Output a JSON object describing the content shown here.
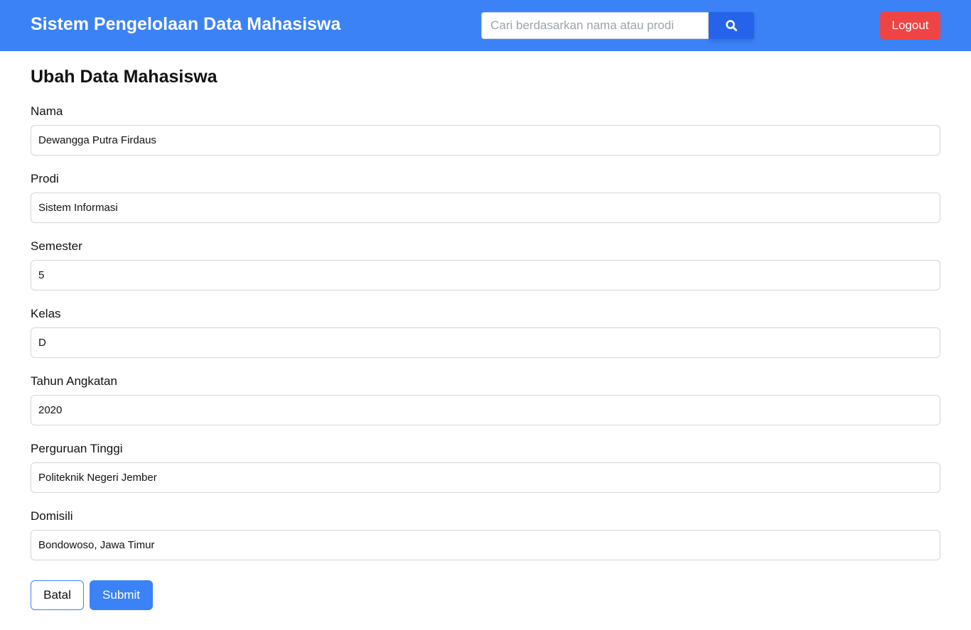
{
  "header": {
    "title": "Sistem Pengelolaan Data Mahasiswa",
    "search_placeholder": "Cari berdasarkan nama atau prodi",
    "logout_label": "Logout"
  },
  "page_title": "Ubah Data Mahasiswa",
  "fields": [
    {
      "label": "Nama",
      "value": "Dewangga Putra Firdaus"
    },
    {
      "label": "Prodi",
      "value": "Sistem Informasi"
    },
    {
      "label": "Semester",
      "value": "5"
    },
    {
      "label": "Kelas",
      "value": "D"
    },
    {
      "label": "Tahun Angkatan",
      "value": "2020"
    },
    {
      "label": "Perguruan Tinggi",
      "value": "Politeknik Negeri Jember"
    },
    {
      "label": "Domisili",
      "value": "Bondowoso, Jawa Timur"
    }
  ],
  "actions": {
    "cancel_label": "Batal",
    "submit_label": "Submit"
  },
  "colors": {
    "primary": "#3b82f6",
    "primary_dark": "#2563eb",
    "danger": "#ef4444"
  }
}
